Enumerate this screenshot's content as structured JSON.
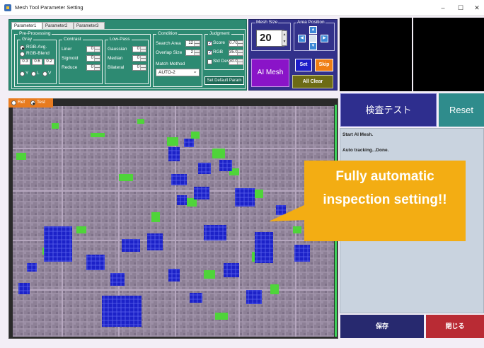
{
  "window": {
    "title": "Mesh Tool Parameter Setting",
    "minimize": "–",
    "maximize": "☐",
    "close": "✕"
  },
  "tabs": [
    "Parameter1",
    "Parameter2",
    "Parameter3"
  ],
  "preprocessing": {
    "title": "Pre-Processing",
    "gray": {
      "title": "Gray",
      "rgb_avg": "RGB-Avg.",
      "rgb_blend": "RGB-Blend",
      "weights": [
        "0.3",
        "0.6",
        "0.2"
      ],
      "channels": [
        "Y",
        "L",
        "V"
      ]
    },
    "contrast": {
      "title": "Contrast",
      "rows": [
        {
          "label": "Liner",
          "value": "0"
        },
        {
          "label": "Sigmoid",
          "value": "0"
        },
        {
          "label": "Reduce",
          "value": "0"
        }
      ]
    },
    "lowpass": {
      "title": "Low-Pass",
      "rows": [
        {
          "label": "Gaussian",
          "value": "0"
        },
        {
          "label": "Median",
          "value": "0"
        },
        {
          "label": "Bilateral",
          "value": "0"
        }
      ]
    }
  },
  "condition": {
    "title": "Condition",
    "search_area_label": "Search Area",
    "search_area": "12",
    "overlap_label": "Overlap Size",
    "overlap": "2",
    "match_method_label": "Match Method",
    "match_method": "AUTO-2"
  },
  "judgment": {
    "title": "Judgment",
    "score_label": "Score",
    "score": "0.70",
    "rgb_label": "RGB",
    "rgb": "35.0",
    "stddev_label": "Std Dev",
    "stddev": "30.0"
  },
  "set_default": "Set Default Param",
  "mesh": {
    "size_title": "Mesh Size",
    "size": "20",
    "area_title": "Area Position",
    "ai_mesh": "AI Mesh",
    "set": "Set",
    "skip": "Skip",
    "all_clear": "All Clear"
  },
  "view": {
    "ref": "Ref",
    "test": "Test"
  },
  "actions": {
    "test": "検査テスト",
    "reset": "Reset",
    "save": "保存",
    "close": "閉じる"
  },
  "log": [
    "Start AI Mesh.",
    "Auto tracking...Done."
  ],
  "callout": "Fully automatic inspection setting!!",
  "colors": {
    "panel_green": "#2d8a72",
    "mesh_purple": "#32318a",
    "ai_mesh": "#8a14c8",
    "callout": "#f3ad13",
    "reset_teal": "#2f8c8c",
    "close_red": "#b92b34"
  }
}
